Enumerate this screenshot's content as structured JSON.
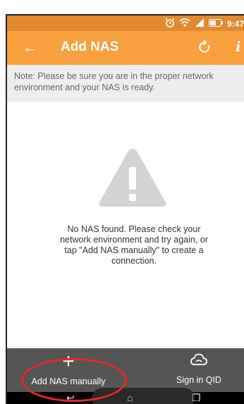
{
  "statusbar": {
    "time": "9:47",
    "icons": [
      "alarm-icon",
      "wifi-icon",
      "signal-icon",
      "battery-icon"
    ]
  },
  "toolbar": {
    "title": "Add NAS",
    "back_icon": "←",
    "info_icon": "i"
  },
  "note": {
    "text": "Note: Please be sure you are in the proper network environment and your NAS is ready."
  },
  "empty_state": {
    "message": "No NAS found. Please check your network environment and try again, or tap \"Add NAS manually\" to create a connection."
  },
  "bottom_actions": {
    "add_icon": "+",
    "add_label": "Add NAS manually",
    "signin_label": "Sign in QID"
  },
  "navbar": {
    "back_icon": "↩",
    "home_icon": "⌂",
    "recents_icon": "❐"
  },
  "colors": {
    "statusbar": "#e2892f",
    "toolbar": "#f7a03d",
    "note_bg": "#eeeeee",
    "bottombar": "#555555",
    "annotation": "#e8262a"
  }
}
